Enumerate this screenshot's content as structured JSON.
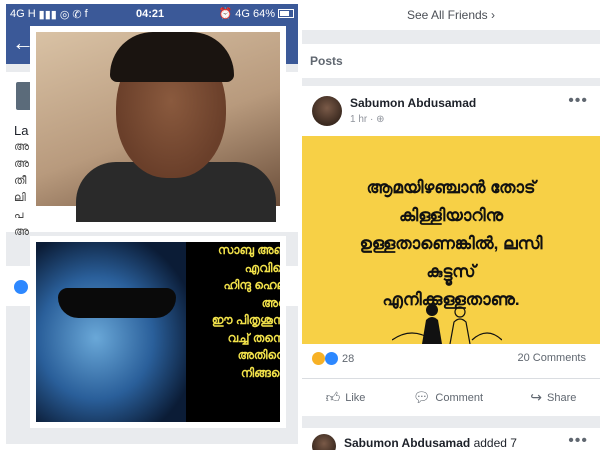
{
  "left_phone": {
    "statusbar": {
      "network_left": "4G",
      "signal_left": "H",
      "time": "04:21",
      "network_right": "4G",
      "battery_percent": "64%"
    },
    "left_text_prefix": "La",
    "left_text_ml": [
      "അ",
      "അ",
      "തീ",
      "ലി",
      "പ",
      "അ"
    ],
    "photo2_caption": [
      "സാബു അബ്ദു",
      "എവിടെ",
      "ഹിന്ദു ഹെല്",
      "അറി",
      "ഈ പിതൃശൂന്യ",
      "വച്ച് തന്നെ",
      "അതിന്റെ",
      "നിങ്ങളെ"
    ]
  },
  "right_phone": {
    "see_all_friends": "See All Friends",
    "posts_label": "Posts",
    "post": {
      "author": "Sabumon Abdusamad",
      "time": "1 hr",
      "image_lines": [
        "ആമയിഴഞ്ചാൻ തോട്",
        "കിള്ളിയാറിനു",
        "ഉള്ളതാണെങ്കിൽ, ലസി",
        "കുട്ടൂസ്",
        "എനിക്കുള്ളതാണു."
      ],
      "reaction_count": "28",
      "comments": "20 Comments",
      "actions": {
        "like": "Like",
        "comment": "Comment",
        "share": "Share"
      }
    },
    "post2": {
      "author": "Sabumon Abdusamad",
      "suffix": "added 7"
    }
  },
  "colors": {
    "facebook_blue": "#3b5998",
    "post_yellow": "#f7d046",
    "like_blue": "#2d88ff"
  }
}
